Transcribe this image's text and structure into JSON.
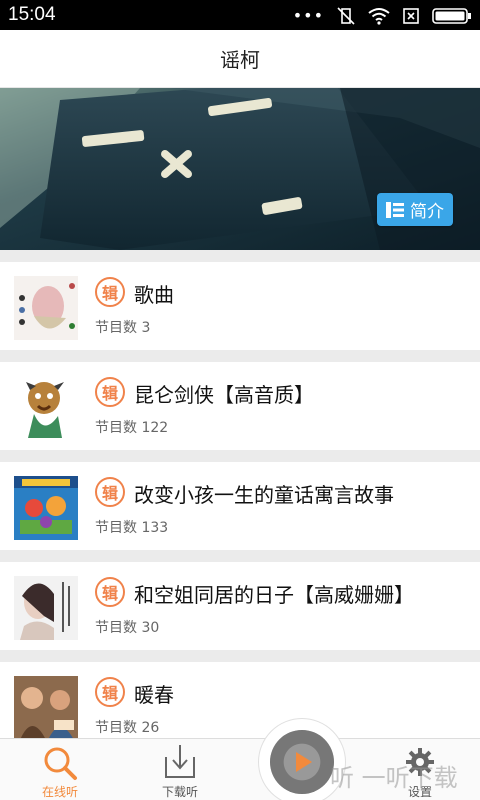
{
  "status_bar": {
    "time": "15:04"
  },
  "header": {
    "title": "谣柯"
  },
  "banner": {
    "intro_label": "简介"
  },
  "badge_label": "辑",
  "albums": [
    {
      "name": "歌曲",
      "count_label": "节目数 3"
    },
    {
      "name": "昆仑剑侠【高音质】",
      "count_label": "节目数 122"
    },
    {
      "name": "改变小孩一生的童话寓言故事",
      "count_label": "节目数 133"
    },
    {
      "name": "和空姐同居的日子【高威姗姗】",
      "count_label": "节目数 30"
    },
    {
      "name": "暖春",
      "count_label": "节目数 26"
    }
  ],
  "tabs": {
    "online": "在线听",
    "download": "下载听",
    "settings": "设置"
  },
  "watermark": "听 一听下载",
  "colors": {
    "accent": "#f28a3c",
    "intro_button": "#3aa6e8"
  }
}
